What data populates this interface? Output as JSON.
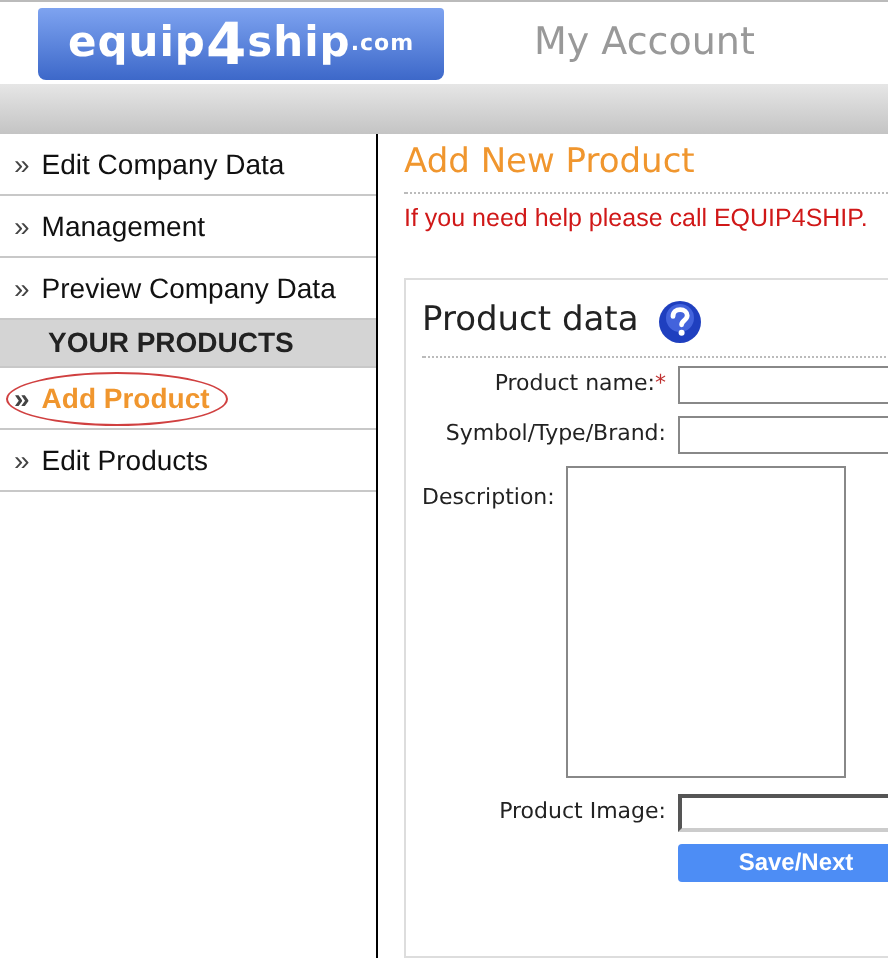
{
  "header": {
    "logo": [
      {
        "text": "equip",
        "kind": "base"
      },
      {
        "text": "4",
        "kind": "big"
      },
      {
        "text": "ship",
        "kind": "base"
      },
      {
        "text": ".com",
        "kind": "small"
      }
    ],
    "title": "My Account"
  },
  "sidebar": {
    "items": [
      {
        "kind": "link",
        "label": "Edit Company Data",
        "marker": "»",
        "selected": false
      },
      {
        "kind": "link",
        "label": "Management",
        "marker": "»",
        "selected": false
      },
      {
        "kind": "link",
        "label": "Preview Company Data",
        "marker": "»",
        "selected": false
      },
      {
        "kind": "section",
        "label": "YOUR PRODUCTS"
      },
      {
        "kind": "link",
        "label": "Add Product",
        "marker": "»",
        "selected": true
      },
      {
        "kind": "link",
        "label": "Edit Products",
        "marker": "»",
        "selected": false
      }
    ]
  },
  "content": {
    "title": "Add New Product",
    "help_text": "If you need help please call EQUIP4SHIP.",
    "form": {
      "title": "Product data",
      "fields": [
        {
          "kind": "text",
          "label": "Product name:",
          "required_mark": "*"
        },
        {
          "kind": "text",
          "label": "Symbol/Type/Brand:"
        },
        {
          "kind": "textarea",
          "label": "Description:"
        },
        {
          "kind": "file",
          "label": "Product Image:"
        }
      ],
      "submit": "Save/Next"
    }
  }
}
